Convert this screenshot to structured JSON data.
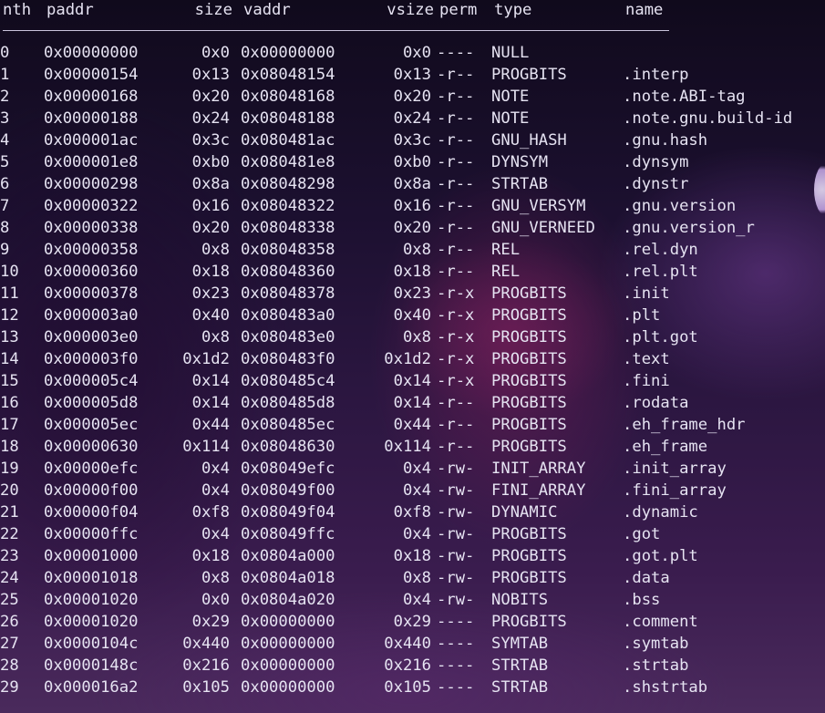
{
  "header": {
    "nth": "nth",
    "paddr": "paddr",
    "size": "size",
    "vaddr": "vaddr",
    "vsize": "vsize",
    "perm": "perm",
    "type": "type",
    "name": "name"
  },
  "sections": [
    {
      "nth": "0",
      "paddr": "0x00000000",
      "size": "0x0",
      "vaddr": "0x00000000",
      "vsize": "0x0",
      "perm": "----",
      "type": "NULL",
      "name": ""
    },
    {
      "nth": "1",
      "paddr": "0x00000154",
      "size": "0x13",
      "vaddr": "0x08048154",
      "vsize": "0x13",
      "perm": "-r--",
      "type": "PROGBITS",
      "name": ".interp"
    },
    {
      "nth": "2",
      "paddr": "0x00000168",
      "size": "0x20",
      "vaddr": "0x08048168",
      "vsize": "0x20",
      "perm": "-r--",
      "type": "NOTE",
      "name": ".note.ABI-tag"
    },
    {
      "nth": "3",
      "paddr": "0x00000188",
      "size": "0x24",
      "vaddr": "0x08048188",
      "vsize": "0x24",
      "perm": "-r--",
      "type": "NOTE",
      "name": ".note.gnu.build-id"
    },
    {
      "nth": "4",
      "paddr": "0x000001ac",
      "size": "0x3c",
      "vaddr": "0x080481ac",
      "vsize": "0x3c",
      "perm": "-r--",
      "type": "GNU_HASH",
      "name": ".gnu.hash"
    },
    {
      "nth": "5",
      "paddr": "0x000001e8",
      "size": "0xb0",
      "vaddr": "0x080481e8",
      "vsize": "0xb0",
      "perm": "-r--",
      "type": "DYNSYM",
      "name": ".dynsym"
    },
    {
      "nth": "6",
      "paddr": "0x00000298",
      "size": "0x8a",
      "vaddr": "0x08048298",
      "vsize": "0x8a",
      "perm": "-r--",
      "type": "STRTAB",
      "name": ".dynstr"
    },
    {
      "nth": "7",
      "paddr": "0x00000322",
      "size": "0x16",
      "vaddr": "0x08048322",
      "vsize": "0x16",
      "perm": "-r--",
      "type": "GNU_VERSYM",
      "name": ".gnu.version"
    },
    {
      "nth": "8",
      "paddr": "0x00000338",
      "size": "0x20",
      "vaddr": "0x08048338",
      "vsize": "0x20",
      "perm": "-r--",
      "type": "GNU_VERNEED",
      "name": ".gnu.version_r"
    },
    {
      "nth": "9",
      "paddr": "0x00000358",
      "size": "0x8",
      "vaddr": "0x08048358",
      "vsize": "0x8",
      "perm": "-r--",
      "type": "REL",
      "name": ".rel.dyn"
    },
    {
      "nth": "10",
      "paddr": "0x00000360",
      "size": "0x18",
      "vaddr": "0x08048360",
      "vsize": "0x18",
      "perm": "-r--",
      "type": "REL",
      "name": ".rel.plt"
    },
    {
      "nth": "11",
      "paddr": "0x00000378",
      "size": "0x23",
      "vaddr": "0x08048378",
      "vsize": "0x23",
      "perm": "-r-x",
      "type": "PROGBITS",
      "name": ".init"
    },
    {
      "nth": "12",
      "paddr": "0x000003a0",
      "size": "0x40",
      "vaddr": "0x080483a0",
      "vsize": "0x40",
      "perm": "-r-x",
      "type": "PROGBITS",
      "name": ".plt"
    },
    {
      "nth": "13",
      "paddr": "0x000003e0",
      "size": "0x8",
      "vaddr": "0x080483e0",
      "vsize": "0x8",
      "perm": "-r-x",
      "type": "PROGBITS",
      "name": ".plt.got"
    },
    {
      "nth": "14",
      "paddr": "0x000003f0",
      "size": "0x1d2",
      "vaddr": "0x080483f0",
      "vsize": "0x1d2",
      "perm": "-r-x",
      "type": "PROGBITS",
      "name": ".text"
    },
    {
      "nth": "15",
      "paddr": "0x000005c4",
      "size": "0x14",
      "vaddr": "0x080485c4",
      "vsize": "0x14",
      "perm": "-r-x",
      "type": "PROGBITS",
      "name": ".fini"
    },
    {
      "nth": "16",
      "paddr": "0x000005d8",
      "size": "0x14",
      "vaddr": "0x080485d8",
      "vsize": "0x14",
      "perm": "-r--",
      "type": "PROGBITS",
      "name": ".rodata"
    },
    {
      "nth": "17",
      "paddr": "0x000005ec",
      "size": "0x44",
      "vaddr": "0x080485ec",
      "vsize": "0x44",
      "perm": "-r--",
      "type": "PROGBITS",
      "name": ".eh_frame_hdr"
    },
    {
      "nth": "18",
      "paddr": "0x00000630",
      "size": "0x114",
      "vaddr": "0x08048630",
      "vsize": "0x114",
      "perm": "-r--",
      "type": "PROGBITS",
      "name": ".eh_frame"
    },
    {
      "nth": "19",
      "paddr": "0x00000efc",
      "size": "0x4",
      "vaddr": "0x08049efc",
      "vsize": "0x4",
      "perm": "-rw-",
      "type": "INIT_ARRAY",
      "name": ".init_array"
    },
    {
      "nth": "20",
      "paddr": "0x00000f00",
      "size": "0x4",
      "vaddr": "0x08049f00",
      "vsize": "0x4",
      "perm": "-rw-",
      "type": "FINI_ARRAY",
      "name": ".fini_array"
    },
    {
      "nth": "21",
      "paddr": "0x00000f04",
      "size": "0xf8",
      "vaddr": "0x08049f04",
      "vsize": "0xf8",
      "perm": "-rw-",
      "type": "DYNAMIC",
      "name": ".dynamic"
    },
    {
      "nth": "22",
      "paddr": "0x00000ffc",
      "size": "0x4",
      "vaddr": "0x08049ffc",
      "vsize": "0x4",
      "perm": "-rw-",
      "type": "PROGBITS",
      "name": ".got"
    },
    {
      "nth": "23",
      "paddr": "0x00001000",
      "size": "0x18",
      "vaddr": "0x0804a000",
      "vsize": "0x18",
      "perm": "-rw-",
      "type": "PROGBITS",
      "name": ".got.plt"
    },
    {
      "nth": "24",
      "paddr": "0x00001018",
      "size": "0x8",
      "vaddr": "0x0804a018",
      "vsize": "0x8",
      "perm": "-rw-",
      "type": "PROGBITS",
      "name": ".data"
    },
    {
      "nth": "25",
      "paddr": "0x00001020",
      "size": "0x0",
      "vaddr": "0x0804a020",
      "vsize": "0x4",
      "perm": "-rw-",
      "type": "NOBITS",
      "name": ".bss"
    },
    {
      "nth": "26",
      "paddr": "0x00001020",
      "size": "0x29",
      "vaddr": "0x00000000",
      "vsize": "0x29",
      "perm": "----",
      "type": "PROGBITS",
      "name": ".comment"
    },
    {
      "nth": "27",
      "paddr": "0x0000104c",
      "size": "0x440",
      "vaddr": "0x00000000",
      "vsize": "0x440",
      "perm": "----",
      "type": "SYMTAB",
      "name": ".symtab"
    },
    {
      "nth": "28",
      "paddr": "0x0000148c",
      "size": "0x216",
      "vaddr": "0x00000000",
      "vsize": "0x216",
      "perm": "----",
      "type": "STRTAB",
      "name": ".strtab"
    },
    {
      "nth": "29",
      "paddr": "0x000016a2",
      "size": "0x105",
      "vaddr": "0x00000000",
      "vsize": "0x105",
      "perm": "----",
      "type": "STRTAB",
      "name": ".shstrtab"
    }
  ]
}
